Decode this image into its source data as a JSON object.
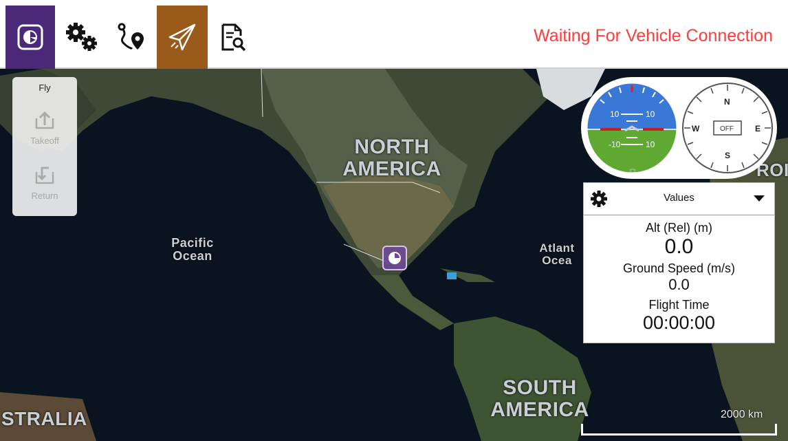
{
  "toolbar": {
    "status": "Waiting For Vehicle Connection",
    "buttons": [
      {
        "name": "app-logo",
        "icon": "qgc-logo-icon",
        "active": true
      },
      {
        "name": "settings",
        "icon": "gears-icon"
      },
      {
        "name": "plan",
        "icon": "plan-route-icon"
      },
      {
        "name": "fly",
        "icon": "paper-plane-icon",
        "active": true
      },
      {
        "name": "analyze",
        "icon": "document-search-icon"
      }
    ]
  },
  "map": {
    "labels": {
      "north_america": "NORTH AMERICA",
      "pacific_ocean": "Pacific Ocean",
      "atlantic_ocean": "Atlant Ocea",
      "south_america": "SOUTH AMERICA",
      "australia": "STRALIA",
      "europe": "ROI"
    },
    "scale": "2000 km"
  },
  "fly_tools": {
    "title": "Fly",
    "tools": [
      {
        "label": "Takeoff",
        "icon": "takeoff-icon",
        "enabled": false
      },
      {
        "label": "Return",
        "icon": "return-icon",
        "enabled": false
      }
    ]
  },
  "instruments": {
    "attitude": {
      "pitch_marks": [
        "10",
        "10",
        "-10",
        "10"
      ]
    },
    "compass": {
      "n": "N",
      "s": "S",
      "e": "E",
      "w": "W",
      "heading": "OFF"
    }
  },
  "values_widget": {
    "title": "Values",
    "items": [
      {
        "label": "Alt (Rel) (m)",
        "value": "0.0"
      },
      {
        "label": "Ground Speed (m/s)",
        "value": "0.0"
      },
      {
        "label": "Flight Time",
        "value": "00:00:00"
      }
    ]
  },
  "colors": {
    "logo_bg": "#4a2a78",
    "fly_active": "#9a5a1c",
    "status_red": "#ff3b3b",
    "sky": "#3a78d8",
    "ground": "#5fa832"
  }
}
